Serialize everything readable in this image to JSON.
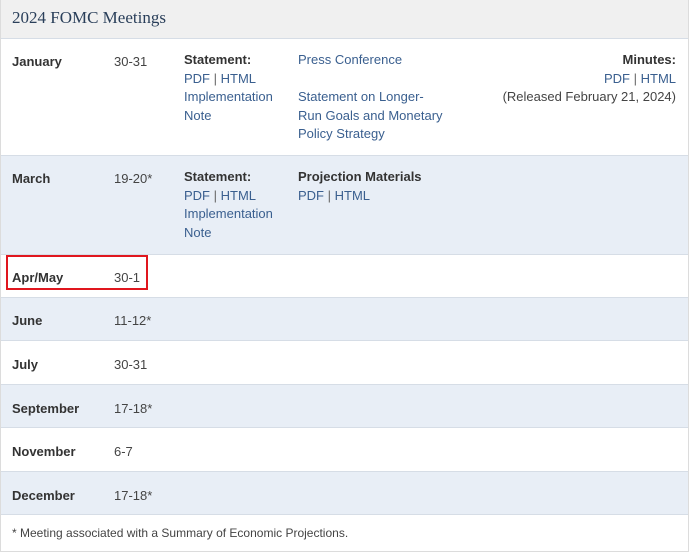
{
  "header": {
    "title": "2024 FOMC Meetings"
  },
  "meetings": [
    {
      "month": "January",
      "dates": "30-31"
    },
    {
      "month": "March",
      "dates": "19-20*"
    },
    {
      "month": "Apr/May",
      "dates": "30-1"
    },
    {
      "month": "June",
      "dates": "11-12*"
    },
    {
      "month": "July",
      "dates": "30-31"
    },
    {
      "month": "September",
      "dates": "17-18*"
    },
    {
      "month": "November",
      "dates": "6-7"
    },
    {
      "month": "December",
      "dates": "17-18*"
    }
  ],
  "january": {
    "statement_label": "Statement:",
    "pdf": "PDF",
    "sep": "|",
    "html": "HTML",
    "impl_line1": "Implementation",
    "impl_line2": "Note",
    "press_conference": "Press Conference",
    "longrun_line1": "Statement on Longer-",
    "longrun_line2": "Run Goals and Monetary",
    "longrun_line3": "Policy Strategy",
    "minutes_label": "Minutes:",
    "minutes_pdf": "PDF",
    "minutes_html": "HTML",
    "minutes_released": "(Released February 21, 2024)"
  },
  "march": {
    "statement_label": "Statement:",
    "pdf": "PDF",
    "sep": "|",
    "html": "HTML",
    "impl_line1": "Implementation",
    "impl_line2": "Note",
    "projection_label": "Projection Materials",
    "projection_pdf": "PDF",
    "projection_html": "HTML"
  },
  "footnote": "* Meeting associated with a Summary of Economic Projections.",
  "colors": {
    "highlight": "#e0161e",
    "alt_row": "#e8eef6",
    "link": "#3a5f8f"
  }
}
